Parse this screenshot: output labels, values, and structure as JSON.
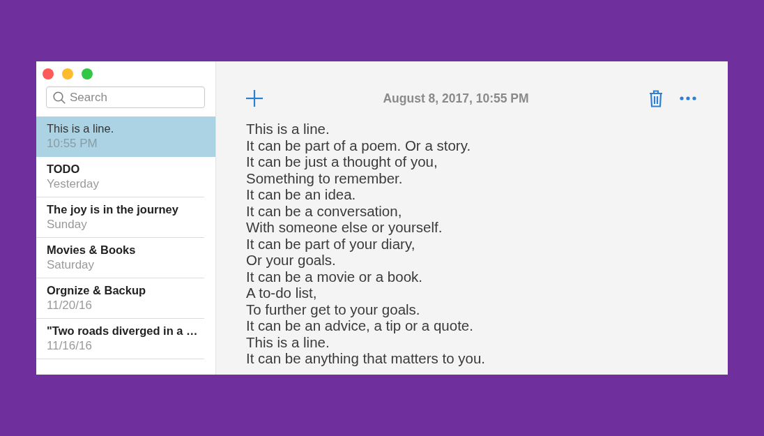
{
  "window": {
    "controls": [
      {
        "color": "#fc5b57"
      },
      {
        "color": "#fdbb2e"
      },
      {
        "color": "#33c748"
      }
    ]
  },
  "sidebar": {
    "search": {
      "placeholder": "Search"
    },
    "notes": [
      {
        "title": "This is a line.",
        "date": "10:55 PM",
        "selected": true
      },
      {
        "title": "TODO",
        "date": "Yesterday",
        "selected": false
      },
      {
        "title": "The joy is in the journey",
        "date": "Sunday",
        "selected": false
      },
      {
        "title": "Movies & Books",
        "date": "Saturday",
        "selected": false
      },
      {
        "title": "Orgnize & Backup",
        "date": "11/20/16",
        "selected": false
      },
      {
        "title": "\"Two roads diverged in a …",
        "date": "11/16/16",
        "selected": false
      }
    ]
  },
  "editor": {
    "toolbar": {
      "date": "August 8, 2017, 10:55 PM"
    },
    "lines": [
      "This is a line.",
      "It can be part of a poem. Or a story.",
      "It can be just a thought of you,",
      "Something to remember.",
      "It can be an idea.",
      "It can be a conversation,",
      "With someone else or yourself.",
      "It can be part of your diary,",
      "Or your goals.",
      "It can be a movie or a book.",
      "A to-do list,",
      "To further get to your goals.",
      "It can be an advice, a tip or a quote.",
      "This is a line.",
      "It can be anything that matters to you."
    ]
  }
}
